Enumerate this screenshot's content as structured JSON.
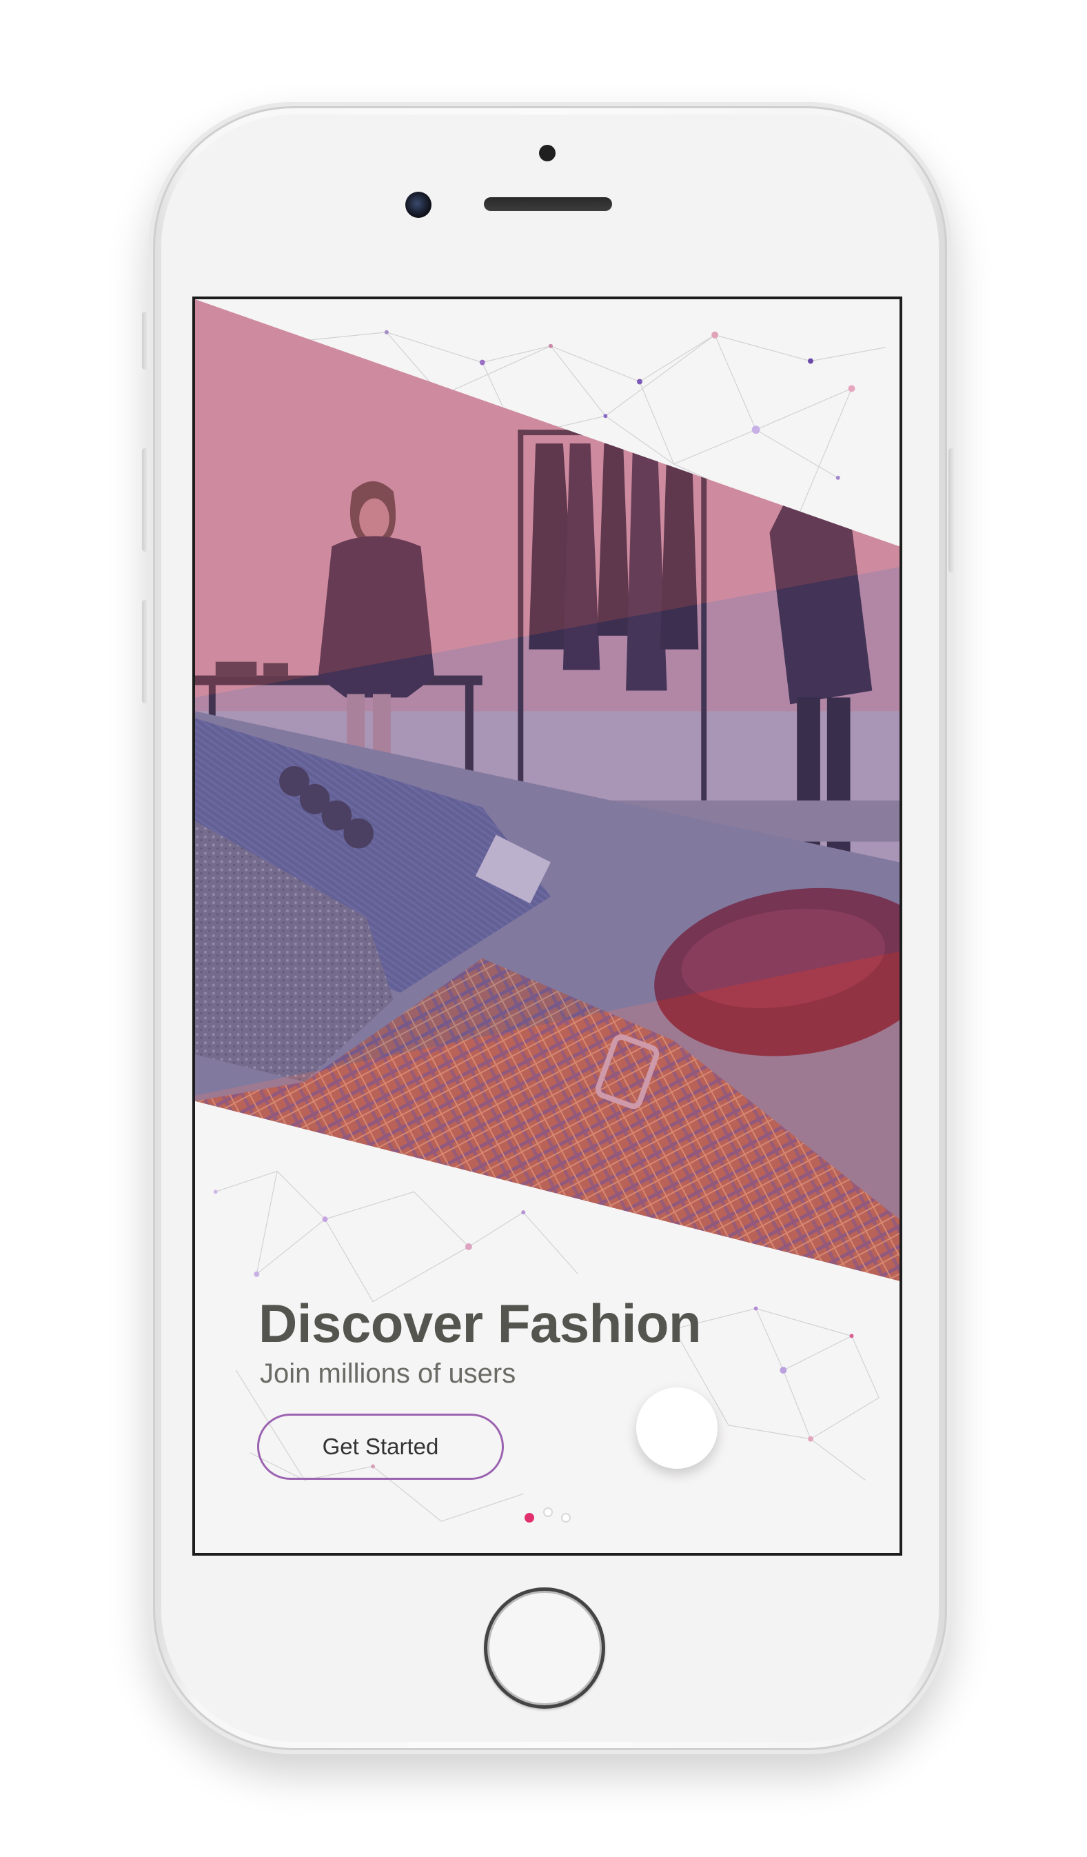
{
  "onboarding": {
    "title": "Discover Fashion",
    "subtitle": "Join millions of users",
    "cta_label": "Get Started",
    "pagination": {
      "total_pages": 3,
      "active_page": 1
    }
  },
  "colors": {
    "accent_pink": "#e0306e",
    "button_border": "#9a62b0",
    "title_text": "#555550",
    "pink_overlay": "#c06a86",
    "purple_overlay": "#6c5896"
  },
  "icons": {
    "background": "constellation-network-pattern",
    "device": "white-smartphone-frame"
  }
}
